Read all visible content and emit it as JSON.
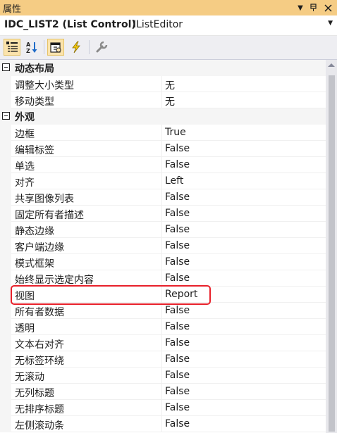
{
  "window": {
    "title": "属性"
  },
  "object": {
    "name": "IDC_LIST2 (List Control)",
    "type": "IListEditor"
  },
  "toolbar": {
    "buttons": [
      "categorized",
      "alphabetical",
      "properties",
      "events",
      "property-pages"
    ]
  },
  "categories": [
    {
      "label": "动态布局",
      "properties": [
        {
          "name": "调整大小类型",
          "value": "无"
        },
        {
          "name": "移动类型",
          "value": "无"
        }
      ]
    },
    {
      "label": "外观",
      "properties": [
        {
          "name": "边框",
          "value": "True"
        },
        {
          "name": "编辑标签",
          "value": "False"
        },
        {
          "name": "单选",
          "value": "False"
        },
        {
          "name": "对齐",
          "value": "Left"
        },
        {
          "name": "共享图像列表",
          "value": "False"
        },
        {
          "name": "固定所有者描述",
          "value": "False"
        },
        {
          "name": "静态边缘",
          "value": "False"
        },
        {
          "name": "客户端边缘",
          "value": "False"
        },
        {
          "name": "模式框架",
          "value": "False"
        },
        {
          "name": "始终显示选定内容",
          "value": "False"
        },
        {
          "name": "视图",
          "value": "Report"
        },
        {
          "name": "所有者数据",
          "value": "False"
        },
        {
          "name": "透明",
          "value": "False"
        },
        {
          "name": "文本右对齐",
          "value": "False"
        },
        {
          "name": "无标签环绕",
          "value": "False"
        },
        {
          "name": "无滚动",
          "value": "False"
        },
        {
          "name": "无列标题",
          "value": "False"
        },
        {
          "name": "无排序标题",
          "value": "False"
        },
        {
          "name": "左侧滚动条",
          "value": "False"
        }
      ]
    }
  ],
  "colors": {
    "titlebar": "#f5cc84",
    "highlight": "#e8202a",
    "toolbar": "#eeeef2"
  }
}
